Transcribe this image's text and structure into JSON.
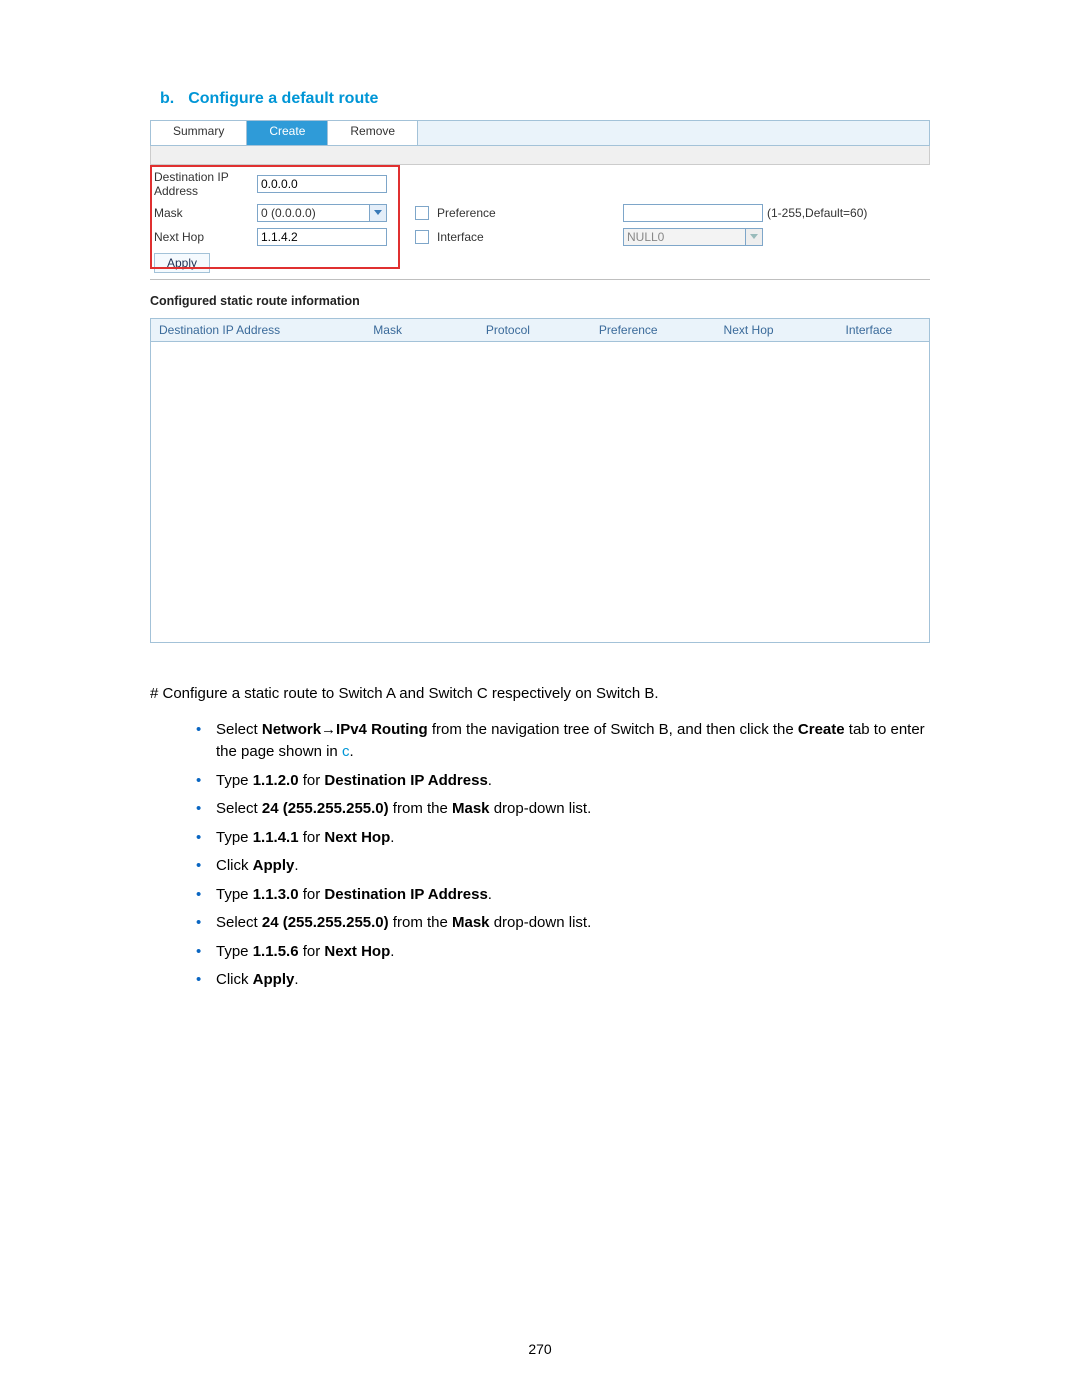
{
  "heading": {
    "letter": "b.",
    "text": "Configure a default route"
  },
  "ui": {
    "tabs": {
      "summary": "Summary",
      "create": "Create",
      "remove": "Remove"
    },
    "form": {
      "destip_label": "Destination IP Address",
      "destip_value": "0.0.0.0",
      "mask_label": "Mask",
      "mask_value": "0 (0.0.0.0)",
      "nexthop_label": "Next Hop",
      "nexthop_value": "1.1.4.2",
      "preference_label": "Preference",
      "preference_hint": "(1-255,Default=60)",
      "interface_label": "Interface",
      "interface_value": "NULL0",
      "apply": "Apply"
    },
    "subheading": "Configured static route information",
    "columns": {
      "c1": "Destination IP Address",
      "c2": "Mask",
      "c3": "Protocol",
      "c4": "Preference",
      "c5": "Next Hop",
      "c6": "Interface"
    }
  },
  "para1": "# Configure a static route to Switch A and Switch C respectively on Switch B.",
  "steps": {
    "s1a": "Select ",
    "s1b": "Network",
    "s1arrow": " → ",
    "s1c": "IPv4 Routing",
    "s1d": " from the navigation tree of Switch B, and then click the ",
    "s1e": "Create",
    "s1f": " tab to enter the page shown in ",
    "s1g": "c",
    "s1h": ".",
    "s2a": "Type ",
    "s2b": "1.1.2.0",
    "s2c": " for ",
    "s2d": "Destination IP Address",
    "s2e": ".",
    "s3a": "Select ",
    "s3b": "24 (255.255.255.0)",
    "s3c": " from the ",
    "s3d": "Mask",
    "s3e": " drop-down list.",
    "s4a": "Type ",
    "s4b": "1.1.4.1",
    "s4c": " for ",
    "s4d": "Next Hop",
    "s4e": ".",
    "s5a": "Click ",
    "s5b": "Apply",
    "s5c": ".",
    "s6a": "Type ",
    "s6b": "1.1.3.0",
    "s6c": " for ",
    "s6d": "Destination IP Address",
    "s6e": ".",
    "s7a": "Select ",
    "s7b": "24 (255.255.255.0)",
    "s7c": " from the ",
    "s7d": "Mask",
    "s7e": " drop-down list.",
    "s8a": "Type ",
    "s8b": "1.1.5.6",
    "s8c": " for ",
    "s8d": "Next Hop",
    "s8e": ".",
    "s9a": "Click ",
    "s9b": "Apply",
    "s9c": "."
  },
  "page_number": "270"
}
